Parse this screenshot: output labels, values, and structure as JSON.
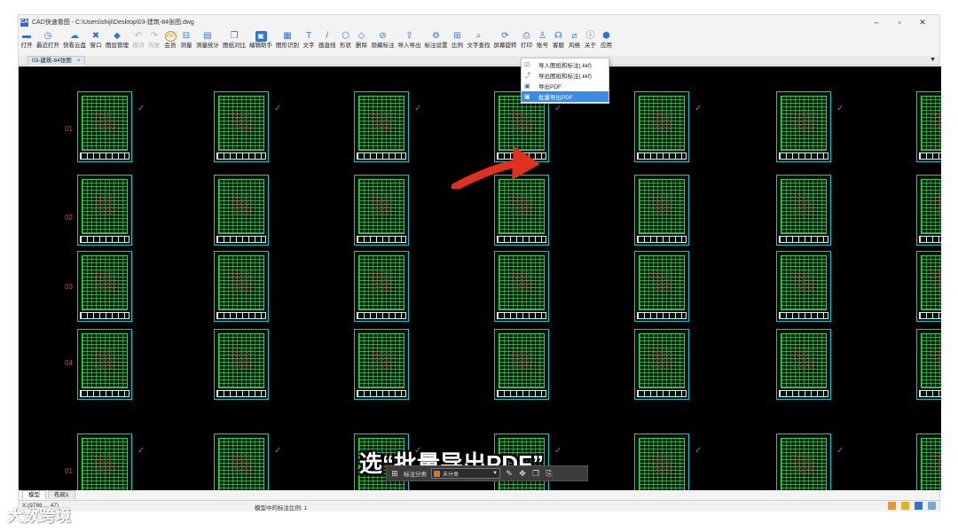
{
  "window": {
    "app_icon": "CAD",
    "title": "CAD快速看图 - C:\\Users\\shiji\\Desktop\\03-建筑-84张图.dwg",
    "controls": [
      "–",
      "▫",
      "✕"
    ]
  },
  "toolbar": {
    "items": [
      {
        "icon": "folder-icon",
        "glyph": "▬",
        "label": "打开"
      },
      {
        "icon": "history-icon",
        "glyph": "◷",
        "label": "最近打开"
      },
      {
        "icon": "cloud-icon",
        "glyph": "☁",
        "label": "快看云盘"
      },
      {
        "icon": "window-icon",
        "glyph": "✖",
        "label": "窗口"
      },
      {
        "icon": "layers-icon",
        "glyph": "◆",
        "label": "图层管理"
      },
      {
        "icon": "undo-icon",
        "glyph": "↶",
        "label": "撤消",
        "disabled": true
      },
      {
        "icon": "redo-icon",
        "glyph": "↷",
        "label": "恢复",
        "disabled": true
      },
      {
        "icon": "vip-icon",
        "glyph": "VIP",
        "label": "会员",
        "orange": true
      },
      {
        "icon": "measure-icon",
        "glyph": "⊟",
        "label": "测量"
      },
      {
        "icon": "measure-stats-icon",
        "glyph": "▤",
        "label": "测量统计"
      },
      {
        "icon": "compare-icon",
        "glyph": "❐",
        "label": "图纸对比"
      },
      {
        "icon": "assistant-icon",
        "glyph": "▣",
        "label": "编辑助手",
        "box": true
      },
      {
        "icon": "recognize-icon",
        "glyph": "▦",
        "label": "图形识别"
      },
      {
        "icon": "text-icon",
        "glyph": "T",
        "label": "文字"
      },
      {
        "icon": "line-icon",
        "glyph": "/",
        "label": "画直线"
      },
      {
        "icon": "shape-icon",
        "glyph": "⬡",
        "label": "形状"
      },
      {
        "icon": "eraser-icon",
        "glyph": "◇",
        "label": "删除"
      },
      {
        "icon": "hide-icon",
        "glyph": "⊘",
        "label": "隐藏标注"
      },
      {
        "icon": "import-export-icon",
        "glyph": "⇪",
        "label": "导入导出"
      },
      {
        "icon": "annot-settings-icon",
        "glyph": "⚙",
        "label": "标注设置"
      },
      {
        "icon": "ratio-icon",
        "glyph": "⊞",
        "label": "比例"
      },
      {
        "icon": "text-search-icon",
        "glyph": "⌕",
        "label": "文字查找"
      },
      {
        "icon": "screen-rotate-icon",
        "glyph": "⟳",
        "label": "屏幕旋转"
      },
      {
        "icon": "print-icon",
        "glyph": "⎙",
        "label": "打印"
      },
      {
        "icon": "account-icon",
        "glyph": "♙",
        "label": "账号"
      },
      {
        "icon": "headset-icon",
        "glyph": "☊",
        "label": "客服"
      },
      {
        "icon": "style-icon",
        "glyph": "⧄",
        "label": "风格"
      },
      {
        "icon": "info-icon",
        "glyph": "ⓘ",
        "label": "关于"
      },
      {
        "icon": "apps-icon",
        "glyph": "⬢",
        "label": "应用"
      }
    ]
  },
  "tabs": {
    "document_tab": "03-建筑-84张图",
    "close": "×",
    "menu_arrow": "▼"
  },
  "canvas": {
    "row_numbers": [
      "01",
      "02",
      "03",
      "04",
      "01"
    ]
  },
  "dropdown": {
    "items": [
      {
        "icon": "import-annot-icon",
        "glyph": "☑",
        "label": "导入图纸和标注(.kkf)"
      },
      {
        "icon": "export-annot-icon",
        "glyph": "⤴",
        "label": "导出图纸和标注(.kkf)"
      },
      {
        "icon": "pdf-icon",
        "glyph": "▣",
        "label": "导出PDF"
      },
      {
        "icon": "batch-pdf-icon",
        "glyph": "▣",
        "label": "批量导出PDF",
        "active": true
      }
    ]
  },
  "caption": "选“批量导出PDF”",
  "annotation_bar": {
    "label": "标注分类",
    "select_value": "未分类",
    "accent": "#e0701d"
  },
  "layout_tabs": [
    "模型",
    "布局1"
  ],
  "status": {
    "coords": "X:(9786 ... 47)",
    "scale": "模型中的标注比例: 1"
  },
  "watermark": "大数跨境"
}
